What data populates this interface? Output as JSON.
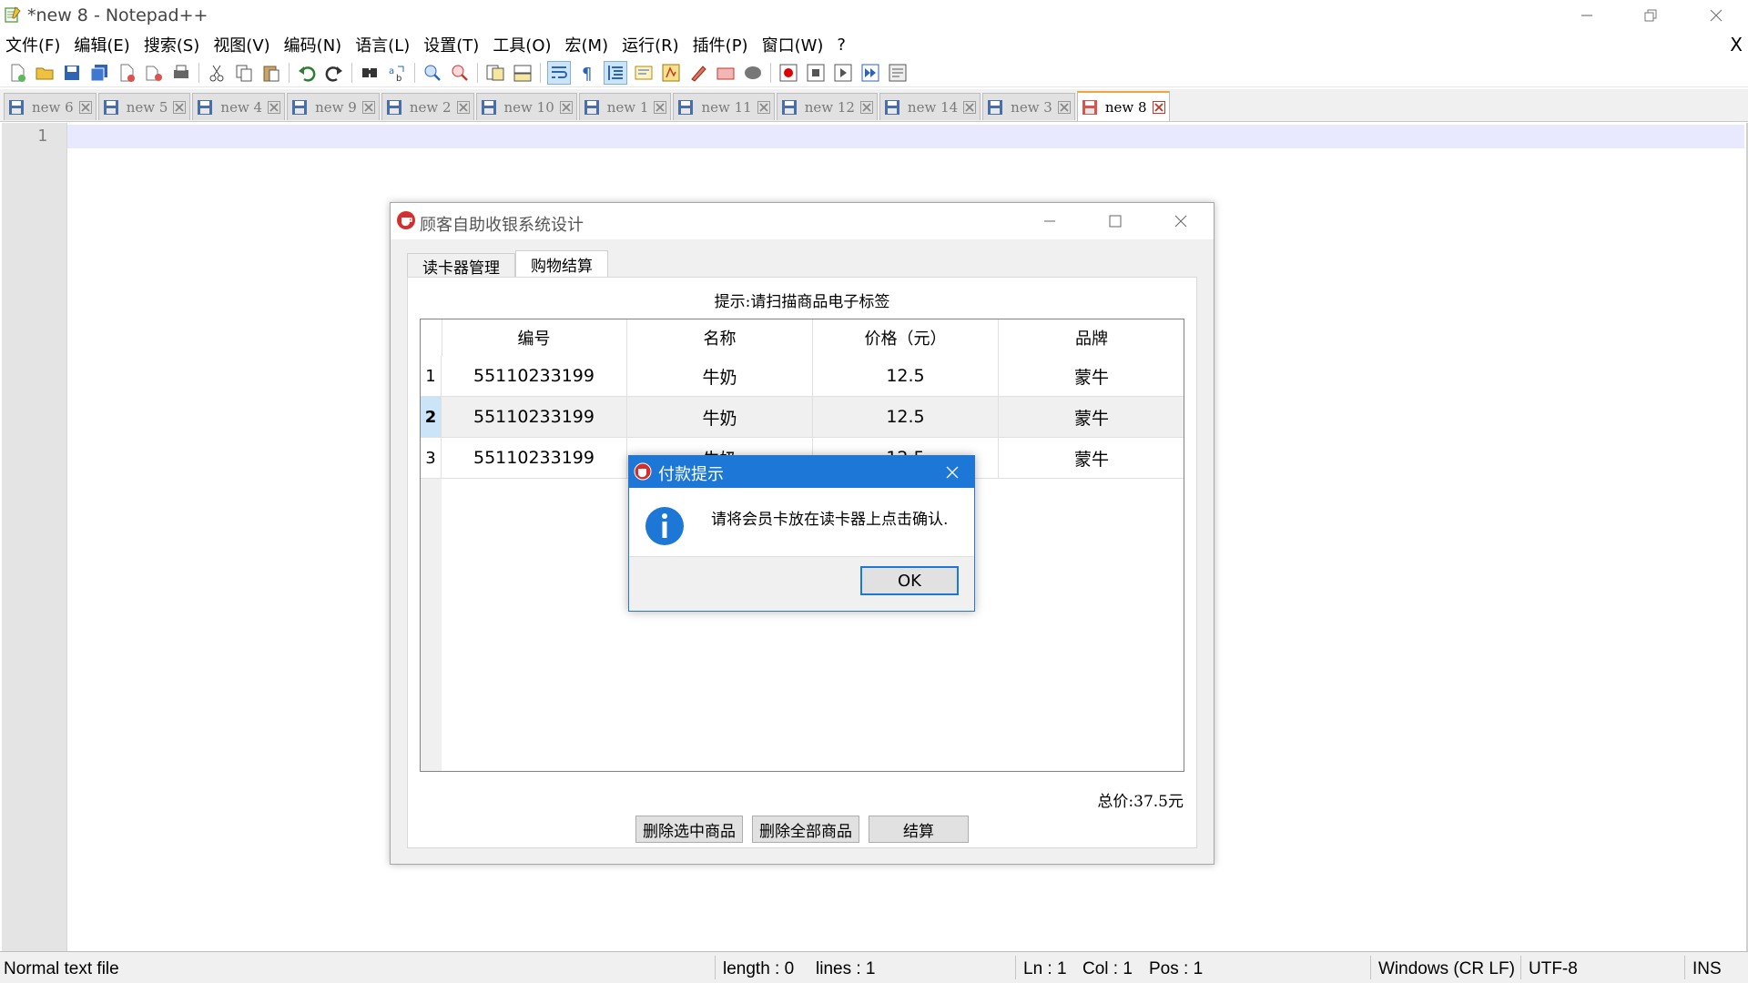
{
  "window": {
    "title": "*new 8 - Notepad++",
    "minimize_icon": "minimize-icon",
    "restore_icon": "restore-icon",
    "close_icon": "close-icon"
  },
  "menu": {
    "items": [
      "文件(F)",
      "编辑(E)",
      "搜索(S)",
      "视图(V)",
      "编码(N)",
      "语言(L)",
      "设置(T)",
      "工具(O)",
      "宏(M)",
      "运行(R)",
      "插件(P)",
      "窗口(W)",
      "?"
    ],
    "close_doc": "X"
  },
  "toolbar": {
    "icons": [
      "new-file-icon",
      "open-file-icon",
      "save-icon",
      "save-all-icon",
      "close-icon",
      "close-all-icon",
      "print-icon",
      "cut-icon",
      "copy-icon",
      "paste-icon",
      "undo-icon",
      "redo-icon",
      "find-icon",
      "replace-icon",
      "zoom-in-icon",
      "zoom-out-icon",
      "sync-vertical-icon",
      "sync-horizontal-icon",
      "word-wrap-icon",
      "show-all-chars-icon",
      "indent-guide-icon",
      "document-map-icon",
      "function-list-icon",
      "folder-workspace-icon",
      "monitor-icon",
      "panel-icon",
      "record-macro-icon",
      "stop-macro-icon",
      "play-macro-icon",
      "run-macro-multiple-icon",
      "save-macro-icon"
    ]
  },
  "tabs": [
    {
      "label": "new  6",
      "active": false
    },
    {
      "label": "new  5",
      "active": false
    },
    {
      "label": "new  4",
      "active": false
    },
    {
      "label": "new  9",
      "active": false
    },
    {
      "label": "new  2",
      "active": false
    },
    {
      "label": "new  10",
      "active": false
    },
    {
      "label": "new  1",
      "active": false
    },
    {
      "label": "new  11",
      "active": false
    },
    {
      "label": "new  12",
      "active": false
    },
    {
      "label": "new  14",
      "active": false
    },
    {
      "label": "new  3",
      "active": false
    },
    {
      "label": "new  8",
      "active": true
    }
  ],
  "editor": {
    "line_numbers": [
      "1"
    ]
  },
  "statusbar": {
    "file_type": "Normal text file",
    "length": "length : 0",
    "lines": "lines : 1",
    "ln": "Ln : 1",
    "col": "Col : 1",
    "pos": "Pos : 1",
    "eol": "Windows (CR LF)",
    "encoding": "UTF-8",
    "mode": "INS"
  },
  "app": {
    "title": "顾客自助收银系统设计",
    "tabs": [
      "读卡器管理",
      "购物结算"
    ],
    "selected_tab": 1,
    "hint": "提示:请扫描商品电子标签",
    "table": {
      "headers": [
        "编号",
        "名称",
        "价格（元）",
        "品牌"
      ],
      "rows": [
        {
          "index": "1",
          "cells": [
            "55110233199",
            "牛奶",
            "12.5",
            "蒙牛"
          ],
          "selected": false
        },
        {
          "index": "2",
          "cells": [
            "55110233199",
            "牛奶",
            "12.5",
            "蒙牛"
          ],
          "selected": true
        },
        {
          "index": "3",
          "cells": [
            "55110233199",
            "牛奶",
            "12.5",
            "蒙牛"
          ],
          "selected": false
        }
      ]
    },
    "total": "总价:37.5元",
    "buttons": [
      "删除选中商品",
      "删除全部商品",
      "结算"
    ]
  },
  "dialog": {
    "title": "付款提示",
    "message": "请将会员卡放在读卡器上点击确认.",
    "ok": "OK",
    "icon": "info-icon"
  },
  "colors": {
    "accent_blue": "#1c77d6",
    "tab_active_marker": "#f1a53b",
    "current_line": "#e8e8ff",
    "selected_row_header": "#cce4f7"
  }
}
